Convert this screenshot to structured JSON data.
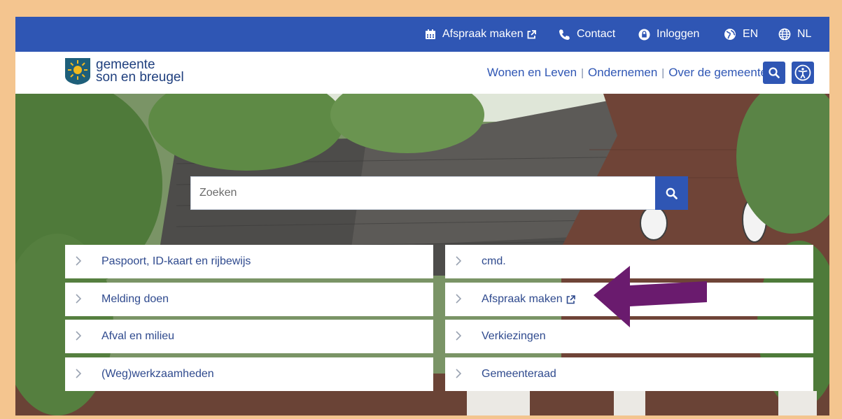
{
  "topbar": {
    "items": [
      {
        "label": "Afspraak maken",
        "icon": "calendar-icon",
        "external": true
      },
      {
        "label": "Contact",
        "icon": "phone-icon"
      },
      {
        "label": "Inloggen",
        "icon": "lock-icon"
      },
      {
        "label": "EN",
        "icon": "globe-icon"
      },
      {
        "label": "NL",
        "icon": "globe-icon"
      }
    ]
  },
  "header": {
    "logo_line1": "gemeente",
    "logo_line2": "son en breugel",
    "nav": [
      "Wonen en Leven",
      "Ondernemen",
      "Over de gemeente"
    ],
    "search_icon": "search-icon",
    "accessibility_icon": "accessibility-icon"
  },
  "hero": {
    "search_placeholder": "Zoeken",
    "tiles_left": [
      "Paspoort, ID-kaart en rijbewijs",
      "Melding doen",
      "Afval en milieu",
      "(Weg)werkzaamheden"
    ],
    "tiles_right": [
      "cmd.",
      "Afspraak maken",
      "Verkiezingen",
      "Gemeenteraad"
    ]
  },
  "colors": {
    "brand": "#2f56b4",
    "frame": "#f4c58f",
    "arrow": "#6a1b6e"
  }
}
